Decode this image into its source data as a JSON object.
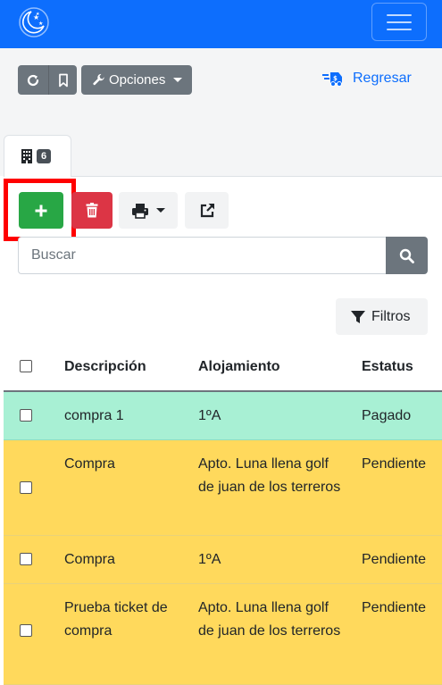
{
  "colors": {
    "primary": "#0d6efd",
    "success": "#28a745",
    "danger": "#dc3545",
    "secondary": "#6c757d",
    "row_paid": "#a8f0d4",
    "row_pending": "#ffd95c",
    "highlight": "#ff0000"
  },
  "navbar": {
    "logo": "moon-stars-logo",
    "toggler": "hamburger-icon"
  },
  "toolbar": {
    "reload_icon": "reload-icon",
    "bookmark_icon": "bookmark-icon",
    "options_label": "Opciones",
    "options_icon": "wrench-icon",
    "back_label": "Regresar",
    "back_icon": "fast-delivery-icon"
  },
  "tab": {
    "icon": "building-icon",
    "badge": "6"
  },
  "actions": {
    "add_icon": "plus-icon",
    "delete_icon": "trash-icon",
    "print_icon": "printer-icon",
    "export_icon": "external-link-icon"
  },
  "search": {
    "placeholder": "Buscar",
    "value": "",
    "icon": "search-icon"
  },
  "filters": {
    "label": "Filtros",
    "icon": "filter-icon"
  },
  "table": {
    "columns": [
      "Descripción",
      "Alojamiento",
      "Estatus"
    ],
    "rows": [
      {
        "description": "compra 1",
        "lodging": "1ºA",
        "status": "Pagado"
      },
      {
        "description": "Compra",
        "lodging": "Apto. Luna llena golf de juan de los terreros",
        "status": "Pendiente"
      },
      {
        "description": "Compra",
        "lodging": "1ºA",
        "status": "Pendiente"
      },
      {
        "description": "Prueba ticket de compra",
        "lodging": "Apto. Luna llena golf de juan de los terreros",
        "status": "Pendiente"
      }
    ]
  }
}
